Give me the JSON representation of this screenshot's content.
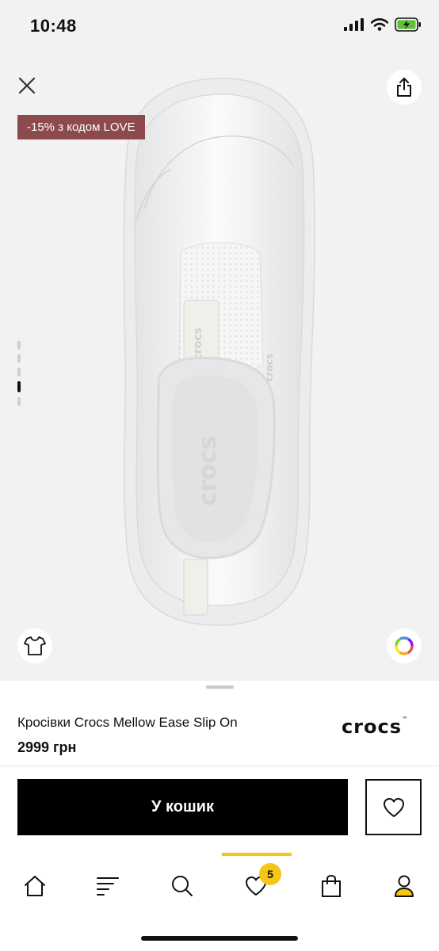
{
  "status_bar": {
    "time": "10:48"
  },
  "hero": {
    "promo_badge": "-15% з кодом LOVE",
    "promo_color": "#8c4a4e",
    "gallery": {
      "count": 5,
      "active_index": 3
    },
    "icons": {
      "close": "close-icon",
      "share": "share-icon",
      "size_guide": "tshirt-icon",
      "colors": "color-wheel-icon"
    }
  },
  "product": {
    "title": "Кросівки Crocs Mellow Ease Slip On",
    "price": "2999 грн",
    "brand": "crocs"
  },
  "actions": {
    "add_to_cart_label": "У кошик",
    "wishlist_icon": "heart-icon"
  },
  "bottom_nav": {
    "accent_color": "#f5c518",
    "active": "wishlist",
    "items": [
      {
        "id": "home",
        "icon": "home-icon"
      },
      {
        "id": "catalog",
        "icon": "menu-icon"
      },
      {
        "id": "search",
        "icon": "search-icon"
      },
      {
        "id": "wishlist",
        "icon": "heart-icon",
        "badge": "5"
      },
      {
        "id": "cart",
        "icon": "shopping-bag-icon"
      },
      {
        "id": "profile",
        "icon": "user-icon"
      }
    ]
  }
}
